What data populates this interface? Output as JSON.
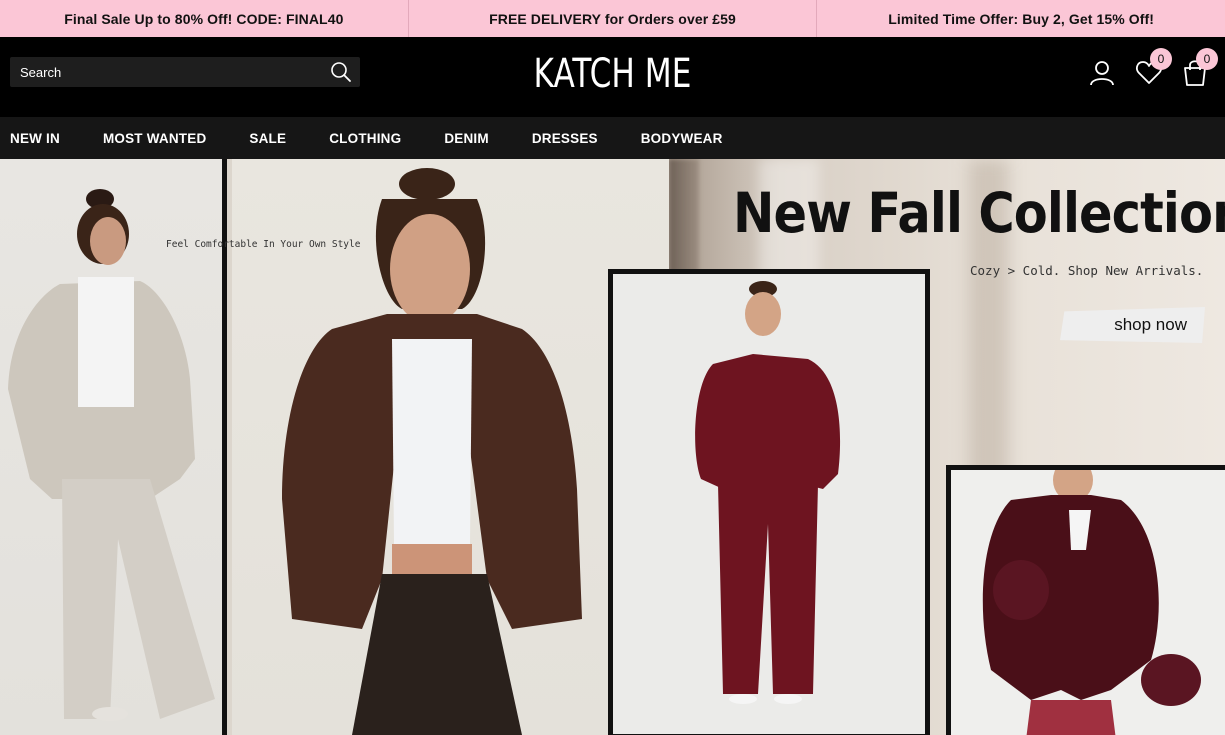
{
  "promo": {
    "items": [
      "Final Sale Up to 80% Off! CODE: FINAL40",
      "FREE DELIVERY for Orders over £59",
      "Limited Time Offer: Buy 2, Get 15% Off!"
    ]
  },
  "header": {
    "search_placeholder": "Search",
    "logo": "KATCH ME",
    "wishlist_count": "0",
    "cart_count": "0"
  },
  "nav": {
    "items": [
      "NEW IN",
      "MOST WANTED",
      "SALE",
      "CLOTHING",
      "DENIM",
      "DRESSES",
      "BODYWEAR"
    ]
  },
  "hero": {
    "tagline": "Feel Comfortable In Your Own Style",
    "title": "New Fall Collection",
    "subtitle": "Cozy > Cold.  Shop New Arrivals.",
    "cta": "shop now"
  },
  "colors": {
    "promo_bg": "#fbc6d6",
    "header_bg": "#000000",
    "nav_bg": "#161616"
  }
}
